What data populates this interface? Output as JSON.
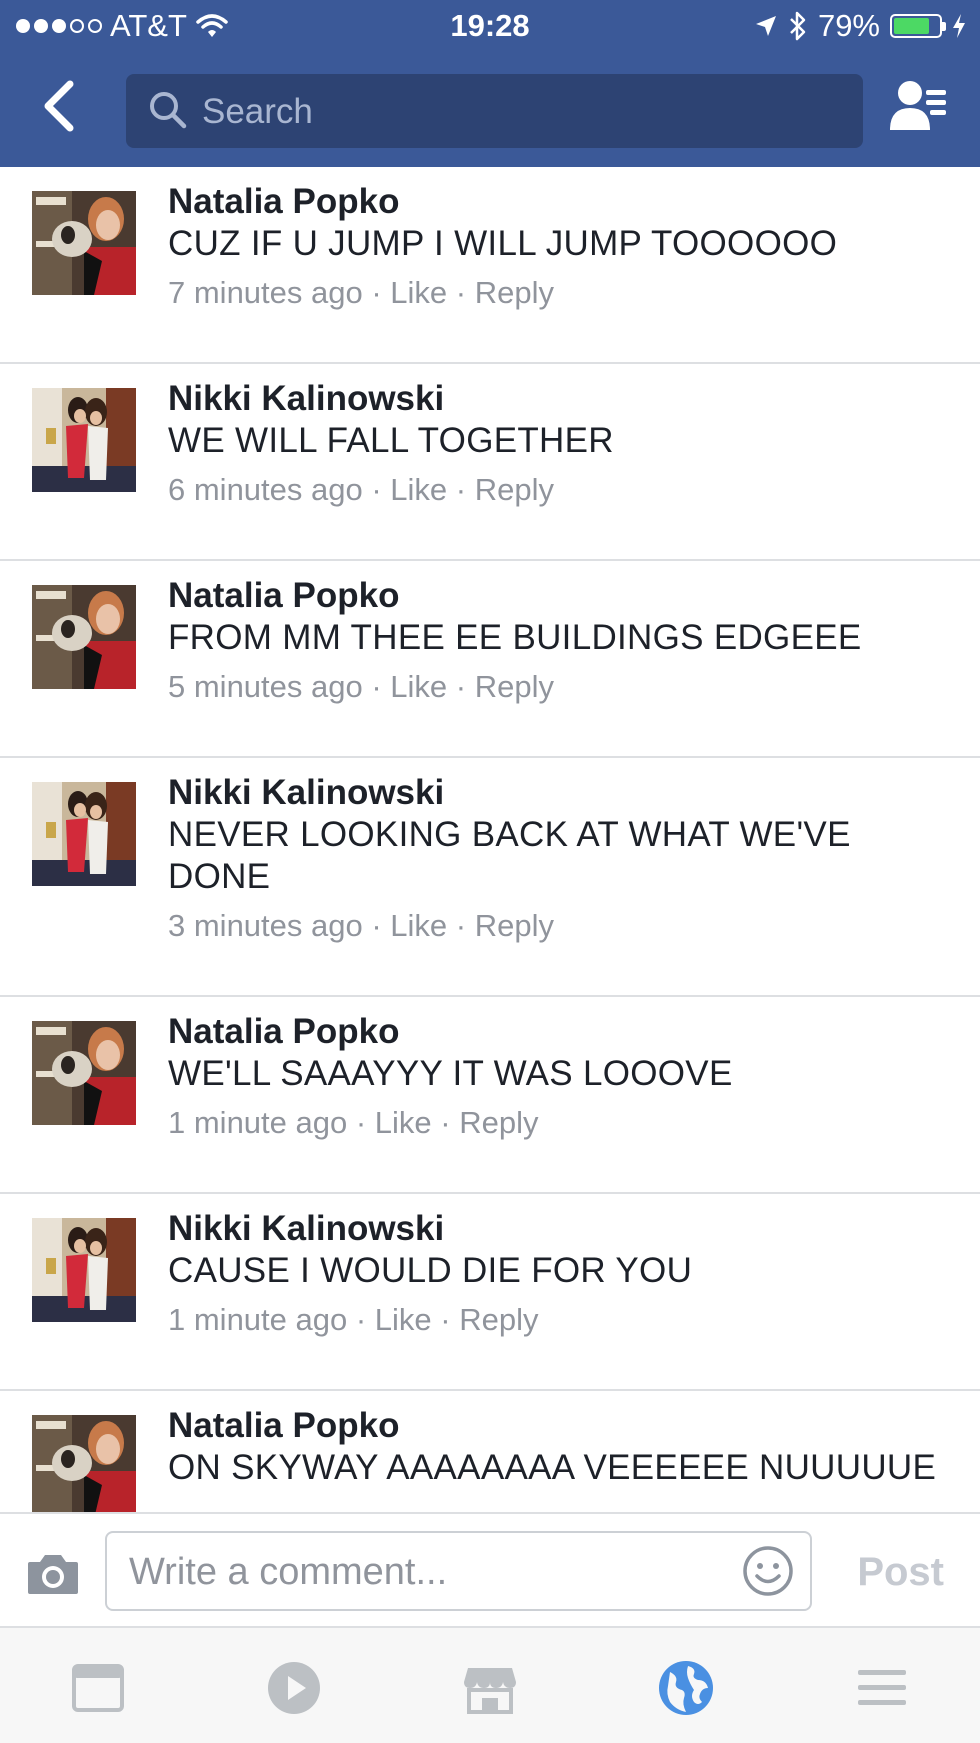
{
  "status_bar": {
    "carrier": "AT&T",
    "time": "19:28",
    "battery": "79%",
    "battery_level": 0.79,
    "signal_bars_filled": 3,
    "signal_bars_total": 5
  },
  "nav": {
    "search_placeholder": "Search"
  },
  "comments": [
    {
      "name": "Natalia Popko",
      "text": "CUZ IF U JUMP I WILL JUMP TOOOOOO",
      "time": "7 minutes ago",
      "like": "Like",
      "reply": "Reply",
      "avatar": "natalia"
    },
    {
      "name": "Nikki Kalinowski",
      "text": "WE WILL FALL TOGETHER",
      "time": "6 minutes ago",
      "like": "Like",
      "reply": "Reply",
      "avatar": "nikki"
    },
    {
      "name": "Natalia Popko",
      "text": "FROM MM THEE EE BUILDINGS EDGEEE",
      "time": "5 minutes ago",
      "like": "Like",
      "reply": "Reply",
      "avatar": "natalia"
    },
    {
      "name": "Nikki Kalinowski",
      "text": "NEVER LOOKING BACK AT WHAT WE'VE DONE",
      "time": "3 minutes ago",
      "like": "Like",
      "reply": "Reply",
      "avatar": "nikki"
    },
    {
      "name": "Natalia Popko",
      "text": "WE'LL SAAAYYY IT WAS LOOOVE",
      "time": "1 minute ago",
      "like": "Like",
      "reply": "Reply",
      "avatar": "natalia"
    },
    {
      "name": "Nikki Kalinowski",
      "text": "CAUSE I WOULD DIE FOR YOU",
      "time": "1 minute ago",
      "like": "Like",
      "reply": "Reply",
      "avatar": "nikki"
    },
    {
      "name": "Natalia Popko",
      "text": "ON SKYWAY AAAAAAAA VEEEEEE NUUUUUE",
      "time": "",
      "like": "",
      "reply": "",
      "avatar": "natalia"
    }
  ],
  "composer": {
    "placeholder": "Write a comment...",
    "post_label": "Post"
  },
  "tab_bar": {
    "tabs": [
      {
        "icon": "news-feed-icon",
        "active": false
      },
      {
        "icon": "video-icon",
        "active": false
      },
      {
        "icon": "marketplace-icon",
        "active": false
      },
      {
        "icon": "notifications-globe-icon",
        "active": true
      },
      {
        "icon": "menu-icon",
        "active": false
      }
    ]
  },
  "colors": {
    "brand": "#3b5998",
    "active_tab": "#4a90e2",
    "muted_text": "#90949c"
  }
}
